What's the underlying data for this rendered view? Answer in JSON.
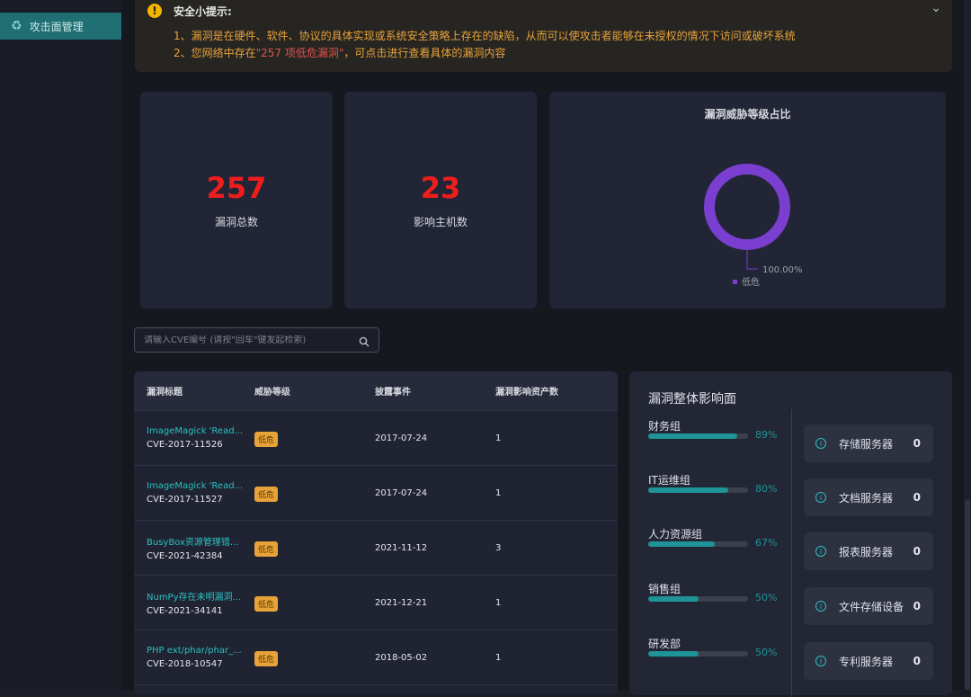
{
  "sidebar": {
    "active_item": "攻击面管理"
  },
  "notice": {
    "title": "安全小提示:",
    "line1": "1、漏洞是在硬件、软件、协议的具体实现或系统安全策略上存在的缺陷，从而可以使攻击者能够在未授权的情况下访问或破坏系统",
    "line2_prefix": "2、您网络中存在",
    "line2_highlight": "\"257 项低危漏洞\"",
    "line2_suffix": "，可点击进行查看具体的漏洞内容"
  },
  "stats": [
    {
      "value": "257",
      "label": "漏洞总数"
    },
    {
      "value": "23",
      "label": "影响主机数"
    }
  ],
  "chart_data": {
    "type": "pie",
    "title": "漏洞威胁等级占比",
    "categories": [
      "低危"
    ],
    "values": [
      100.0
    ],
    "data_labels": [
      "100.00%"
    ],
    "colors": [
      "#7a3fd0"
    ],
    "legend_position": "bottom"
  },
  "search": {
    "placeholder": "请输入CVE编号 (请按\"回车\"键发起检索)"
  },
  "table": {
    "headers": [
      "漏洞标题",
      "威胁等级",
      "披露事件",
      "漏洞影响资产数"
    ],
    "rows": [
      {
        "title": "ImageMagick 'Read...",
        "cve": "CVE-2017-11526",
        "level": "低危",
        "date": "2017-07-24",
        "assets": "1"
      },
      {
        "title": "ImageMagick 'Read...",
        "cve": "CVE-2017-11527",
        "level": "低危",
        "date": "2017-07-24",
        "assets": "1"
      },
      {
        "title": "BusyBox资源管理错...",
        "cve": "CVE-2021-42384",
        "level": "低危",
        "date": "2021-11-12",
        "assets": "3"
      },
      {
        "title": "NumPy存在未明漏洞...",
        "cve": "CVE-2021-34141",
        "level": "低危",
        "date": "2021-12-21",
        "assets": "1"
      },
      {
        "title": "PHP ext/phar/phar_...",
        "cve": "CVE-2018-10547",
        "level": "低危",
        "date": "2018-05-02",
        "assets": "1"
      }
    ]
  },
  "impact": {
    "title": "漏洞整体影响面",
    "groups": [
      {
        "name": "财务组",
        "pct_text": "89%",
        "pct": 89
      },
      {
        "name": "IT运维组",
        "pct_text": "80%",
        "pct": 80
      },
      {
        "name": "人力资源组",
        "pct_text": "67%",
        "pct": 67
      },
      {
        "name": "销售组",
        "pct_text": "50%",
        "pct": 50
      },
      {
        "name": "研发部",
        "pct_text": "50%",
        "pct": 50
      }
    ],
    "assets": [
      {
        "name": "存储服务器",
        "count": "0"
      },
      {
        "name": "文档服务器",
        "count": "0"
      },
      {
        "name": "报表服务器",
        "count": "0"
      },
      {
        "name": "文件存储设备",
        "count": "0"
      },
      {
        "name": "专利服务器",
        "count": "0"
      }
    ]
  }
}
